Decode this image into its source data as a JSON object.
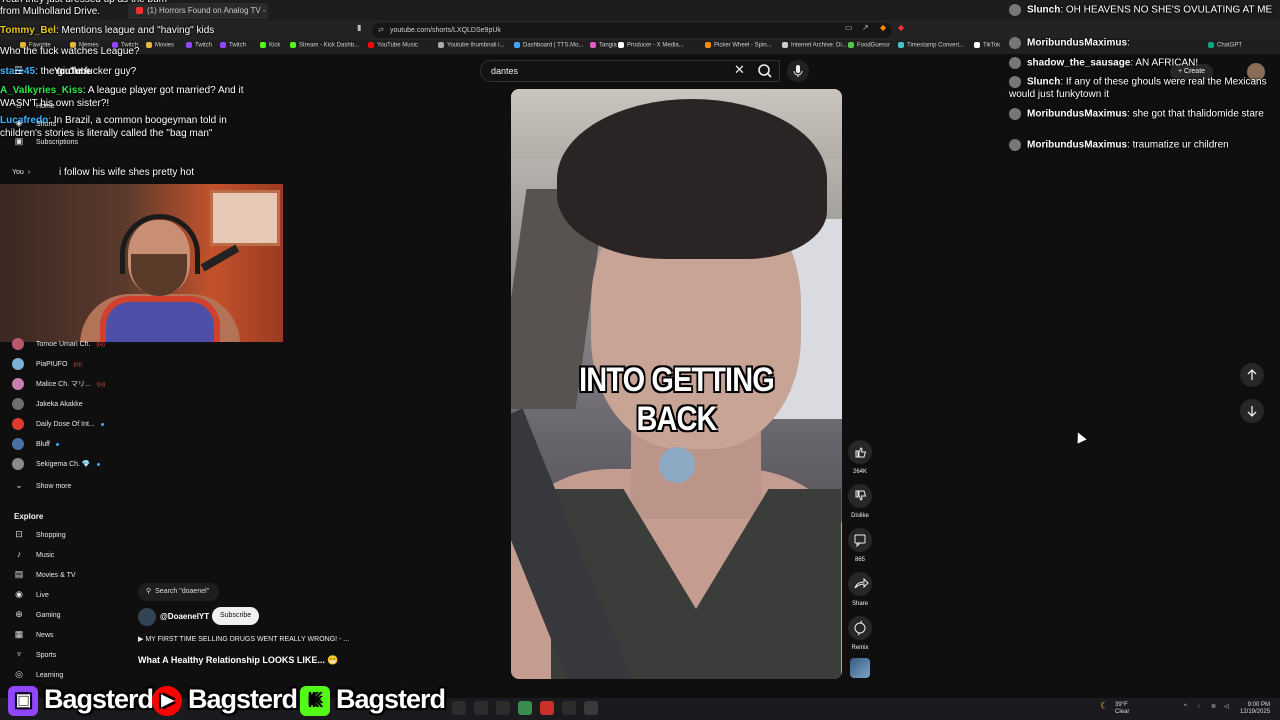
{
  "browser": {
    "tabs": [
      {
        "label": "(1) Horrors Found on Analog TV - Yo"
      }
    ],
    "url": "youtube.com/shorts/LXQLDSe9pUk",
    "bookmarks": [
      {
        "label": "Favorite",
        "color": "#e8b83b"
      },
      {
        "label": "Memes",
        "color": "#e8b83b"
      },
      {
        "label": "Twitch",
        "color": "#9147ff"
      },
      {
        "label": "Movies",
        "color": "#e8b83b"
      },
      {
        "label": "Twitch",
        "color": "#9147ff"
      },
      {
        "label": "Twitch",
        "color": "#9147ff"
      },
      {
        "label": "Kick",
        "color": "#53fc18"
      },
      {
        "label": "Stream - Kick Dashb...",
        "color": "#53fc18"
      },
      {
        "label": "YouTube Music",
        "color": "#ff0000"
      },
      {
        "label": "Youtube thumbnail i...",
        "color": "#aaaaaa"
      },
      {
        "label": "Dashboard | TTS.Mo...",
        "color": "#3ea6ff"
      },
      {
        "label": "Tangia",
        "color": "#e05cc4"
      },
      {
        "label": "Producer - X Media...",
        "color": "#ffffff"
      },
      {
        "label": "Picker Wheel - Spin...",
        "color": "#ff8a00"
      },
      {
        "label": "Internet Archive: Di...",
        "color": "#cccccc"
      },
      {
        "label": "FoodGuessr",
        "color": "#53c64b"
      },
      {
        "label": "Timestamp Convert...",
        "color": "#3ec6c6"
      },
      {
        "label": "TikTok",
        "color": "#ffffff"
      },
      {
        "label": "ChatGPT",
        "color": "#10a37f"
      }
    ]
  },
  "youtube": {
    "logo": "YouTube",
    "search_value": "dantes",
    "create_label": "+ Create",
    "sidebar": {
      "top": [
        {
          "label": "Home"
        },
        {
          "label": "Shorts"
        },
        {
          "label": "Subscriptions"
        },
        {
          "label": "You"
        }
      ],
      "channels": [
        {
          "label": "Tomoe Umari Ch.",
          "color": "#b85a6a",
          "badge": "live"
        },
        {
          "label": "PiaPIUFO",
          "color": "#7ab3d8",
          "badge": "live"
        },
        {
          "label": "Malice Ch. マリ...",
          "color": "#c77fae",
          "badge": "live"
        },
        {
          "label": "Jakeka Akakke",
          "color": "#6d6d6d",
          "badge": ""
        },
        {
          "label": "Daily Dose Of Int...",
          "color": "#e23b2e",
          "badge": "dot"
        },
        {
          "label": "Bluff",
          "color": "#4a6fa5",
          "badge": "dot"
        },
        {
          "label": "Sekigema Ch. 💎",
          "color": "#8a8a8a",
          "badge": "dot"
        }
      ],
      "show_more": "Show more",
      "explore_heading": "Explore",
      "explore": [
        {
          "label": "Shopping",
          "icon": "shopping-bag-icon"
        },
        {
          "label": "Music",
          "icon": "music-note-icon"
        },
        {
          "label": "Movies & TV",
          "icon": "film-icon"
        },
        {
          "label": "Live",
          "icon": "live-icon"
        },
        {
          "label": "Gaming",
          "icon": "gamepad-icon"
        },
        {
          "label": "News",
          "icon": "news-icon"
        },
        {
          "label": "Sports",
          "icon": "trophy-icon"
        },
        {
          "label": "Learning",
          "icon": "lightbulb-icon"
        }
      ]
    },
    "short": {
      "caption": "INTO GETTING BACK",
      "search_chip": "Search \"doaenel\"",
      "channel": "@DoaenelYT",
      "subscribe": "Subscribe",
      "music": "MY FIRST TIME SELLING DRUGS WENT REALLY WRONG! - ...",
      "title": "What A Healthy Relationship LOOKS LIKE... 😁",
      "actions": {
        "likes": "264K",
        "dislike": "Dislike",
        "comments": "865",
        "share": "Share",
        "remix": "Remix"
      }
    }
  },
  "left_chat": [
    {
      "user": "",
      "text": "Yeah they just dressed up as the bum",
      "color": "#ffffff"
    },
    {
      "user": "",
      "text": "from Mulholland Drive.",
      "color": "#ffffff"
    },
    {
      "user": "Tommy_Bel",
      "text": "Mentions league and \"having\" kids",
      "color": "#e6c619"
    },
    {
      "user": "",
      "text": "Who the fuck watches League?",
      "color": "#ffffff"
    },
    {
      "user": "stare45",
      "text": "the girdle fucker guy?",
      "color": "#3cb4ff"
    },
    {
      "user": "A_Valkyries_Kiss",
      "text": "A league player got married? And it",
      "color": "#2ee84b"
    },
    {
      "user": "",
      "text": "WASN'T his own sister?!",
      "color": "#ffffff"
    },
    {
      "user": "Lucafredo",
      "text": "In Brazil, a common boogeyman told in",
      "color": "#3cb4ff"
    },
    {
      "user": "",
      "text": "children's stories is literally called the \"bag man\"",
      "color": "#ffffff"
    },
    {
      "user": "",
      "text": "i follow his wife shes pretty hot",
      "color": "#ffffff"
    }
  ],
  "right_chat": [
    {
      "user": "Slunch",
      "text": "OH HEAVENS NO SHE'S OVULATING AT ME",
      "color": "#ffffff"
    },
    {
      "user": "MoribundusMaximus",
      "text": "",
      "color": "#ffffff"
    },
    {
      "user": "shadow_the_sausage",
      "text": "AN AFRICAN!",
      "color": "#ffffff"
    },
    {
      "user": "Slunch",
      "text": "If any of these ghouls were real the Mexicans would just funkytown it",
      "color": "#ffffff"
    },
    {
      "user": "MoribundusMaximus",
      "text": "she got that thalidomide stare",
      "color": "#ffffff"
    },
    {
      "user": "MoribundusMaximus",
      "text": "traumatize ur children",
      "color": "#ffffff"
    }
  ],
  "stream_bar": [
    {
      "platform": "twitch",
      "handle": "Bagsterd",
      "color": "#9147ff",
      "icon": "twitch-icon"
    },
    {
      "platform": "youtube",
      "handle": "Bagsterd",
      "color": "#ff0000",
      "icon": "youtube-icon"
    },
    {
      "platform": "kick",
      "handle": "Bagsterd",
      "color": "#53fc18",
      "icon": "kick-icon"
    }
  ],
  "taskbar": {
    "weather_temp": "39°F",
    "weather_desc": "Clear",
    "time": "9:00 PM",
    "date": "12/19/2025"
  }
}
